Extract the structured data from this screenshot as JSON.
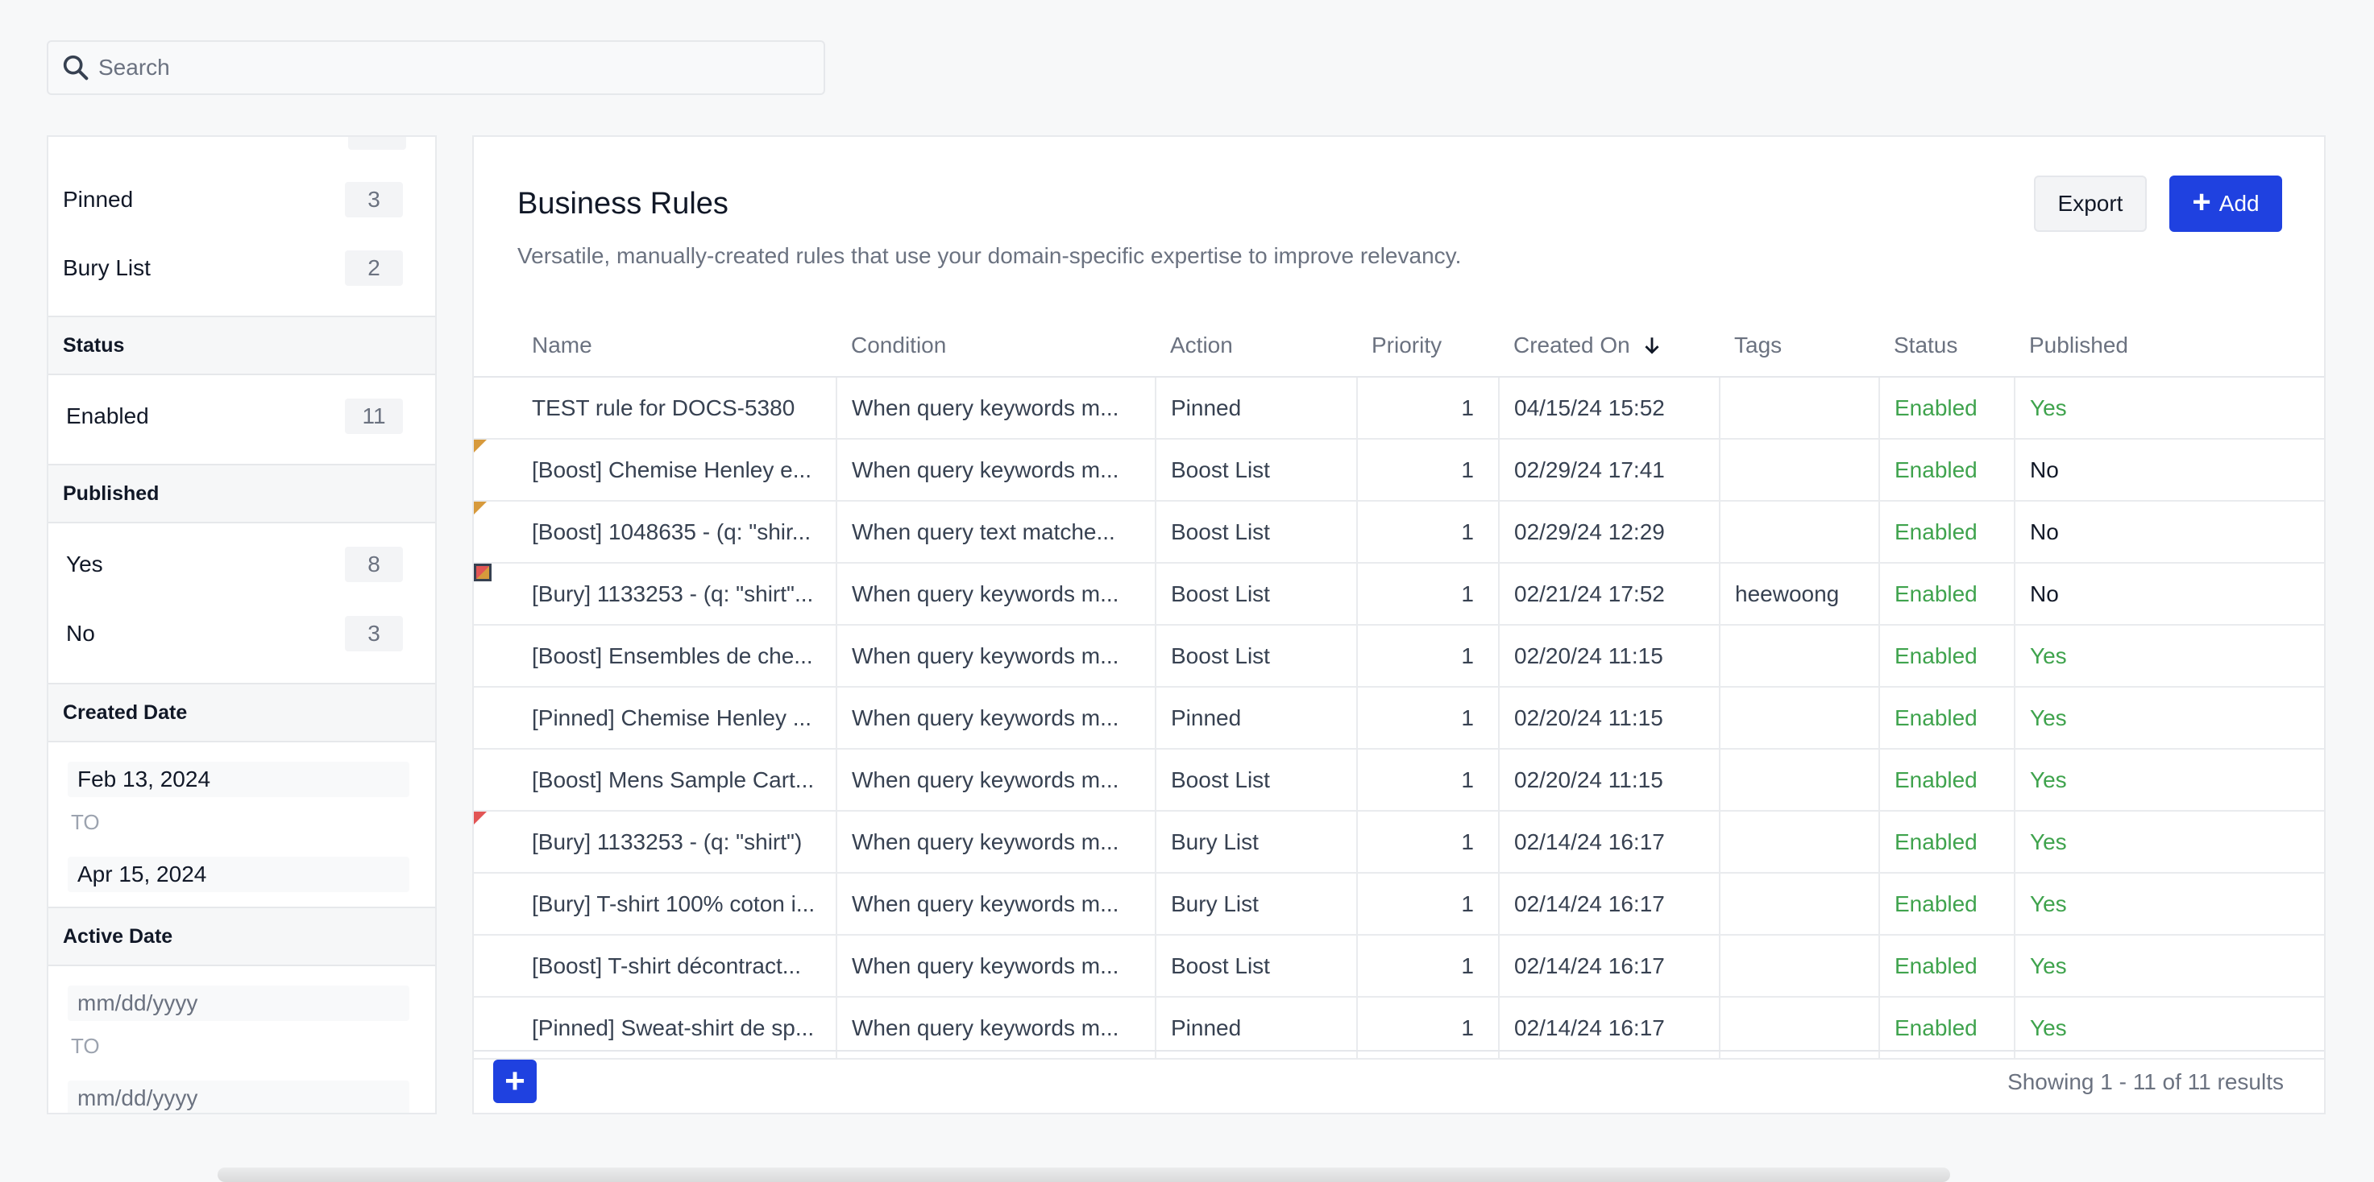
{
  "search": {
    "placeholder": "Search"
  },
  "sidebar": {
    "type_items": [
      {
        "label": "Pinned",
        "count": "3"
      },
      {
        "label": "Bury List",
        "count": "2"
      }
    ],
    "status": {
      "title": "Status",
      "items": [
        {
          "label": "Enabled",
          "count": "11"
        }
      ]
    },
    "published": {
      "title": "Published",
      "items": [
        {
          "label": "Yes",
          "count": "8"
        },
        {
          "label": "No",
          "count": "3"
        }
      ]
    },
    "created_date": {
      "title": "Created Date",
      "from": "Feb 13, 2024",
      "to_label": "TO",
      "to": "Apr 15, 2024"
    },
    "active_date": {
      "title": "Active Date",
      "from_placeholder": "mm/dd/yyyy",
      "to_label": "TO",
      "to_placeholder": "mm/dd/yyyy"
    }
  },
  "main": {
    "title": "Business Rules",
    "subtitle": "Versatile, manually-created rules that use your domain-specific expertise to improve relevancy.",
    "export_label": "Export",
    "add_label": "Add",
    "columns": [
      "Name",
      "Condition",
      "Action",
      "Priority",
      "Created On",
      "Tags",
      "Status",
      "Published"
    ],
    "rows": [
      {
        "flag": "",
        "name": "TEST rule for DOCS-5380",
        "condition": "When query keywords m...",
        "action": "Pinned",
        "priority": "1",
        "created": "04/15/24 15:52",
        "tags": "",
        "status": "Enabled",
        "published": "Yes"
      },
      {
        "flag": "boost",
        "name": "[Boost] Chemise Henley e...",
        "condition": "When query keywords m...",
        "action": "Boost List",
        "priority": "1",
        "created": "02/29/24 17:41",
        "tags": "",
        "status": "Enabled",
        "published": "No"
      },
      {
        "flag": "boost",
        "name": "[Boost] 1048635 - (q: \"shir...",
        "condition": "When query text matche...",
        "action": "Boost List",
        "priority": "1",
        "created": "02/29/24 12:29",
        "tags": "",
        "status": "Enabled",
        "published": "No"
      },
      {
        "flag": "mixed",
        "name": "[Bury] 1133253 - (q: \"shirt\"...",
        "condition": "When query keywords m...",
        "action": "Boost List",
        "priority": "1",
        "created": "02/21/24 17:52",
        "tags": "heewoong",
        "status": "Enabled",
        "published": "No"
      },
      {
        "flag": "",
        "name": "[Boost] Ensembles de che...",
        "condition": "When query keywords m...",
        "action": "Boost List",
        "priority": "1",
        "created": "02/20/24 11:15",
        "tags": "",
        "status": "Enabled",
        "published": "Yes"
      },
      {
        "flag": "",
        "name": "[Pinned] Chemise Henley ...",
        "condition": "When query keywords m...",
        "action": "Pinned",
        "priority": "1",
        "created": "02/20/24 11:15",
        "tags": "",
        "status": "Enabled",
        "published": "Yes"
      },
      {
        "flag": "",
        "name": "[Boost] Mens Sample Cart...",
        "condition": "When query keywords m...",
        "action": "Boost List",
        "priority": "1",
        "created": "02/20/24 11:15",
        "tags": "",
        "status": "Enabled",
        "published": "Yes"
      },
      {
        "flag": "bury",
        "name": "[Bury] 1133253 - (q: \"shirt\")",
        "condition": "When query keywords m...",
        "action": "Bury List",
        "priority": "1",
        "created": "02/14/24 16:17",
        "tags": "",
        "status": "Enabled",
        "published": "Yes"
      },
      {
        "flag": "",
        "name": "[Bury] T-shirt 100% coton i...",
        "condition": "When query keywords m...",
        "action": "Bury List",
        "priority": "1",
        "created": "02/14/24 16:17",
        "tags": "",
        "status": "Enabled",
        "published": "Yes"
      },
      {
        "flag": "",
        "name": "[Boost] T-shirt décontract...",
        "condition": "When query keywords m...",
        "action": "Boost List",
        "priority": "1",
        "created": "02/14/24 16:17",
        "tags": "",
        "status": "Enabled",
        "published": "Yes"
      },
      {
        "flag": "",
        "name": "[Pinned] Sweat-shirt de sp...",
        "condition": "When query keywords m...",
        "action": "Pinned",
        "priority": "1",
        "created": "02/14/24 16:17",
        "tags": "",
        "status": "Enabled",
        "published": "Yes"
      }
    ],
    "footer": {
      "results_text": "Showing 1 - 11 of 11 results"
    }
  },
  "colors": {
    "accent": "#1f41e0",
    "success": "#3fa34d",
    "boost_flag": "#d79a3c",
    "bury_flag": "#e25555"
  },
  "icons": {
    "search": "search-icon",
    "sort": "arrow-down-icon",
    "add": "plus-icon"
  }
}
